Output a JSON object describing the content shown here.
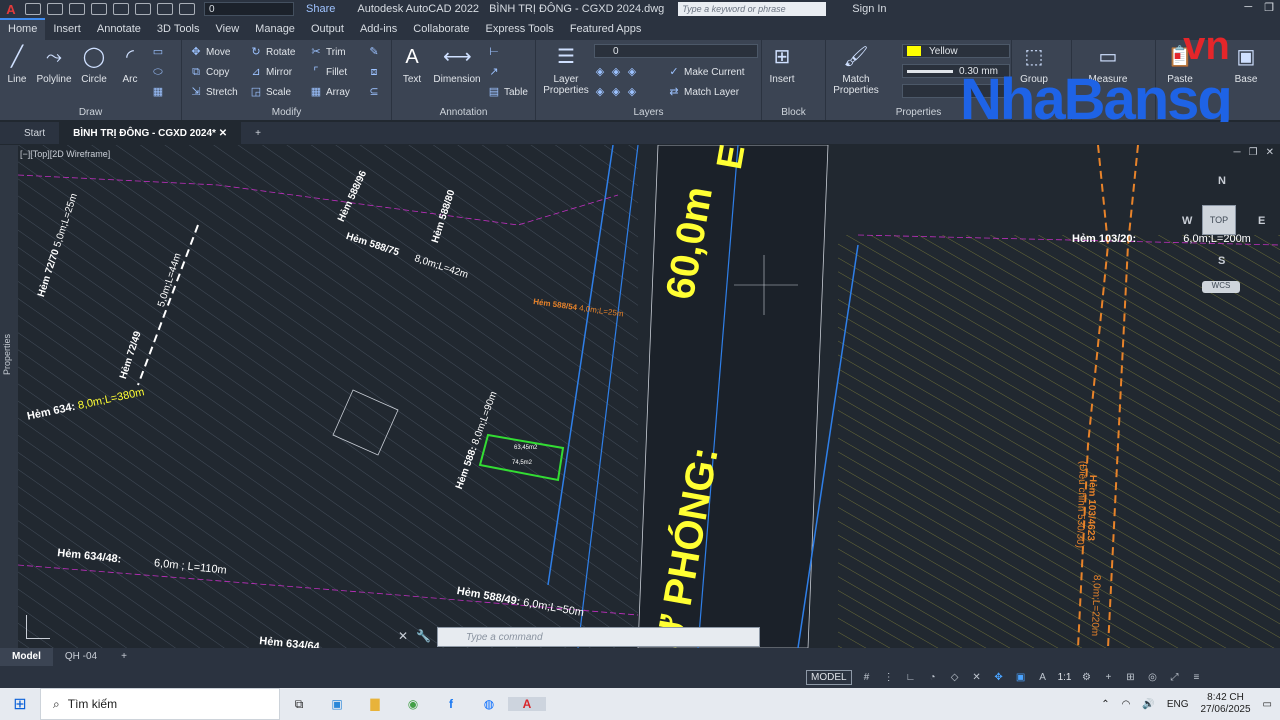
{
  "qat": {
    "layer_value": "0",
    "share_label": "Share",
    "app_title": "Autodesk AutoCAD 2022",
    "doc_title": "BÌNH TRỊ ĐÔNG - CGXD 2024.dwg",
    "search_placeholder": "Type a keyword or phrase",
    "signin_label": "Sign In"
  },
  "ribbon_tabs": [
    "Home",
    "Insert",
    "Annotate",
    "3D Tools",
    "View",
    "Manage",
    "Output",
    "Add-ins",
    "Collaborate",
    "Express Tools",
    "Featured Apps"
  ],
  "draw": {
    "title": "Draw",
    "line": "Line",
    "polyline": "Polyline",
    "circle": "Circle",
    "arc": "Arc"
  },
  "modify": {
    "title": "Modify",
    "move": "Move",
    "rotate": "Rotate",
    "trim": "Trim",
    "copy": "Copy",
    "mirror": "Mirror",
    "fillet": "Fillet",
    "stretch": "Stretch",
    "scale": "Scale",
    "array": "Array"
  },
  "annotation": {
    "title": "Annotation",
    "text": "Text",
    "dimension": "Dimension",
    "table": "Table"
  },
  "layers": {
    "title": "Layers",
    "layer_properties": "Layer Properties",
    "make_current": "Make Current",
    "match_layer": "Match Layer",
    "current_layer": "0"
  },
  "block": {
    "title": "Block",
    "insert": "Insert"
  },
  "properties": {
    "title": "Properties",
    "match_properties": "Match Properties",
    "color": "Yellow",
    "lineweight": "0.30 mm",
    "color_hex": "#ffff00"
  },
  "groups": {
    "group": "Group",
    "measure": "Measure"
  },
  "clipboard": {
    "paste": "Paste",
    "base": "Base"
  },
  "watermark": {
    "brand": "NhaBansg",
    "tld": ".vn"
  },
  "doc_tabs": {
    "start": "Start",
    "current": "BÌNH TRỊ ĐÔNG - CGXD 2024*"
  },
  "viewport_label": "[−][Top][2D Wireframe]",
  "side_palette": "Properties",
  "drawing_labels": {
    "road_main": "60,0m",
    "road_name": "PHÓNG:",
    "road_name_2": "Ự PHÓNG:",
    "road_letter": "E",
    "hem_72_70": "Hẻm 72/70",
    "hem_72_70_dim": "5,0m;L=25m",
    "hem_72_49": "Hẻm 72/49",
    "hem_72_49_dim": "5,0m;L=44m",
    "hem_634": "Hẻm 634:",
    "hem_634_dim": "8,0m;L=380m",
    "hem_588_75": "Hẻm 588/75",
    "hem_588_75_dim": "8,0m;L=42m",
    "hem_588_96": "Hẻm 588/96",
    "hem_588_80": "Hẻm 588/80",
    "hem_588_54": "Hẻm 588/54",
    "hem_588_54_dim": "4,0m;L=25m",
    "hem_588": "Hẻm 588:",
    "hem_588_dim": "8,0m;L=90m",
    "hem_634_48": "Hẻm 634/48:",
    "hem_634_48_dim": "6,0m ; L=110m",
    "hem_588_49": "Hẻm 588/49:",
    "hem_588_49_dim": "6,0m;L=50m",
    "hem_634_64": "Hẻm 634/64",
    "hem_103_20": "Hẻm 103/20:",
    "hem_103_20_dim": "6,0m;L=200m",
    "hem_103_4623": "Hẻm 103/4623",
    "hem_103_note": "(Điều chỉnh 530/30)",
    "hem_103_4623_dim": "8,0m;L=220m",
    "lot_area_1": "63,45m2",
    "lot_area_2": "74,5m2"
  },
  "navcube": {
    "n": "N",
    "s": "S",
    "e": "E",
    "w": "W",
    "top": "TOP",
    "wcs": "WCS"
  },
  "command": {
    "placeholder": "Type a command"
  },
  "layout_tabs": {
    "model": "Model",
    "layout1": "QH -04"
  },
  "status": {
    "model": "MODEL",
    "scale": "1:1"
  },
  "taskbar": {
    "search": "Tìm kiếm",
    "lang": "ENG",
    "time": "8:42 CH",
    "date": "27/06/2025"
  }
}
